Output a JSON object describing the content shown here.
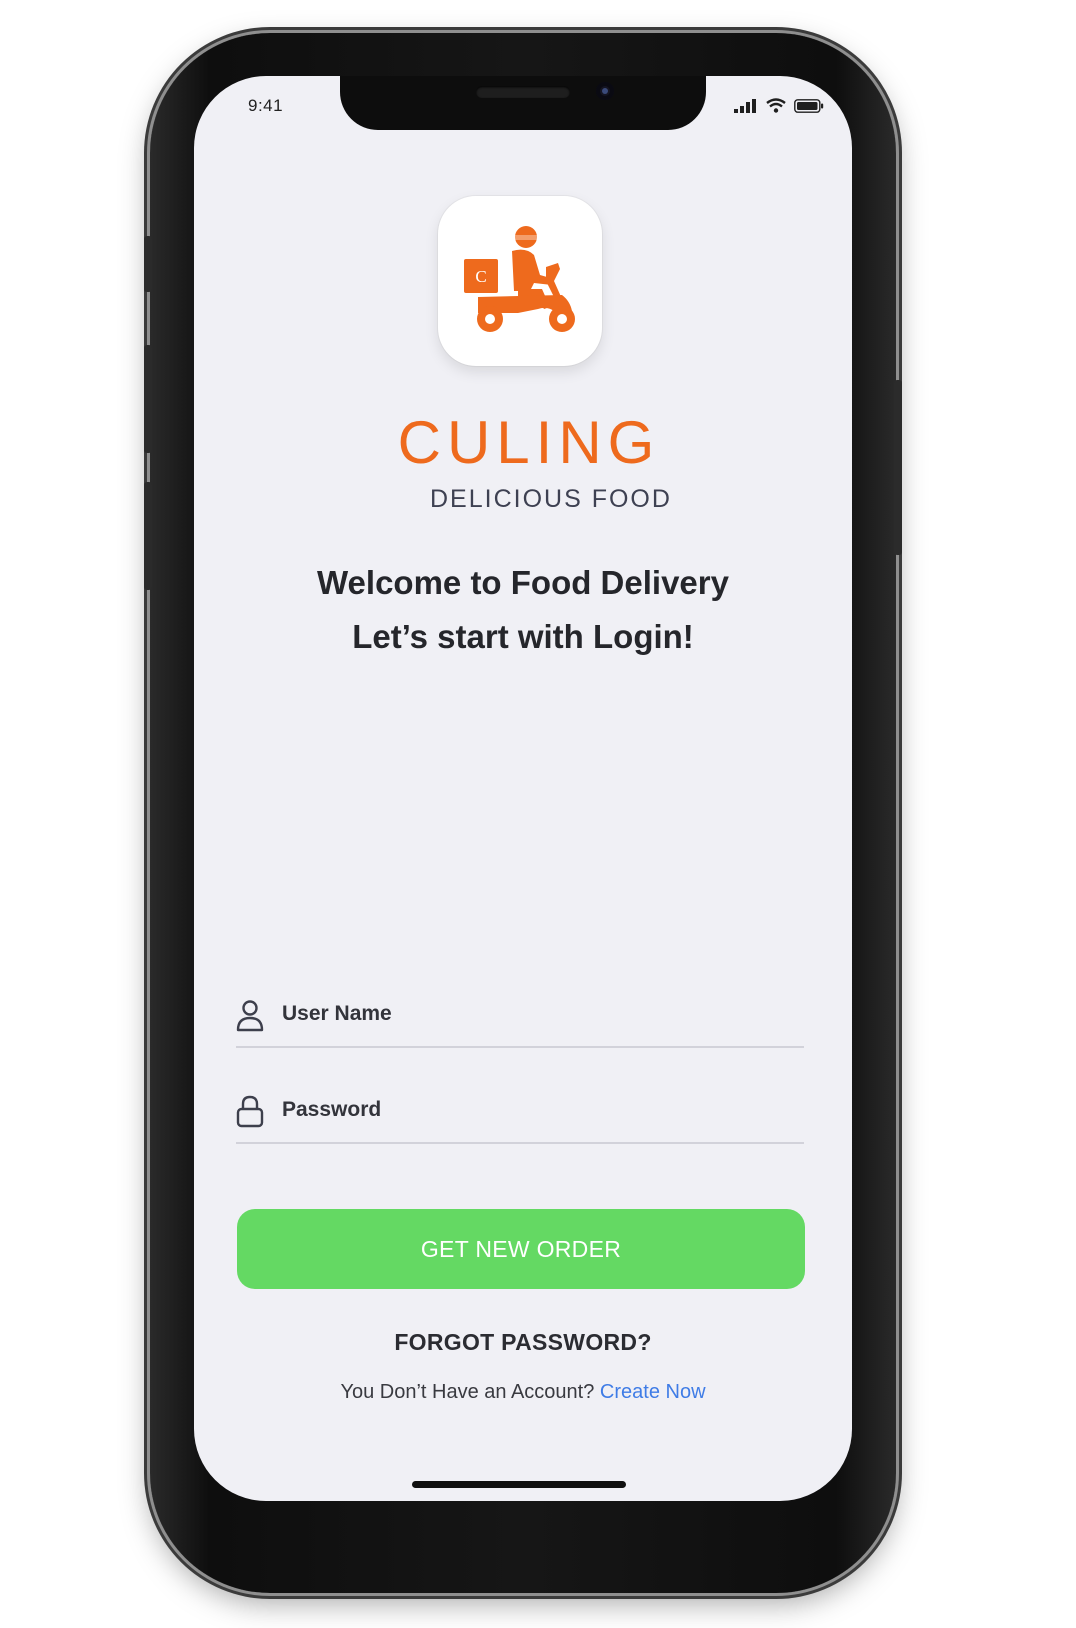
{
  "status_bar": {
    "time": "9:41",
    "icons": [
      "signal-icon",
      "wifi-icon",
      "battery-icon"
    ]
  },
  "app_icon": {
    "icon": "delivery-scooter-icon",
    "badge_letter": "C",
    "color": "#ee6a1d"
  },
  "brand": {
    "name": "CULING",
    "tagline": "DELICIOUS FOOD"
  },
  "welcome": {
    "line1": "Welcome to Food Delivery",
    "line2": "Let’s start with Login!"
  },
  "form": {
    "username_placeholder": "User Name",
    "username_icon": "user-icon",
    "password_placeholder": "Password",
    "password_icon": "lock-icon"
  },
  "actions": {
    "primary_label": "GET NEW ORDER",
    "primary_color": "#64d963",
    "forgot_label": "FORGOT PASSWORD?",
    "signup_prompt": "You Don’t Have an Account?",
    "signup_link": "Create Now",
    "link_color": "#3f7ce6"
  }
}
